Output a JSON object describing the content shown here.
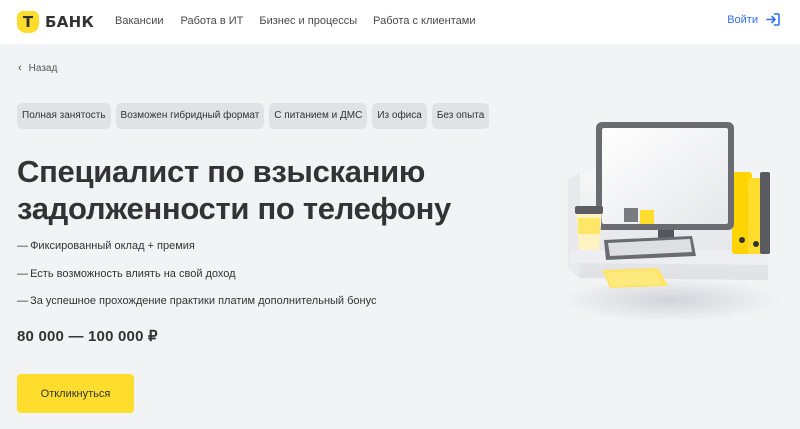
{
  "header": {
    "logo_letter": "Т",
    "logo_text": "БАНК",
    "nav": [
      "Вакансии",
      "Работа в ИТ",
      "Бизнес и процессы",
      "Работа с клиентами"
    ],
    "login_label": "Войти"
  },
  "back_label": "Назад",
  "tags": [
    "Полная занятость",
    "Возможен гибридный формат",
    "С питанием и ДМС",
    "Из офиса",
    "Без опыта"
  ],
  "title_line1": "Специалист по взысканию",
  "title_line2": "задолженности по телефону",
  "bullets": [
    "Фиксированный оклад + премия",
    "Есть возможность влиять на свой доход",
    "За успешное прохождение практики платим дополнительный бонус"
  ],
  "salary": "80 000 — 100 000 ₽",
  "apply_label": "Откликнуться",
  "colors": {
    "accent": "#ffdd2d",
    "link": "#336fee",
    "background": "#f2f3f5"
  }
}
